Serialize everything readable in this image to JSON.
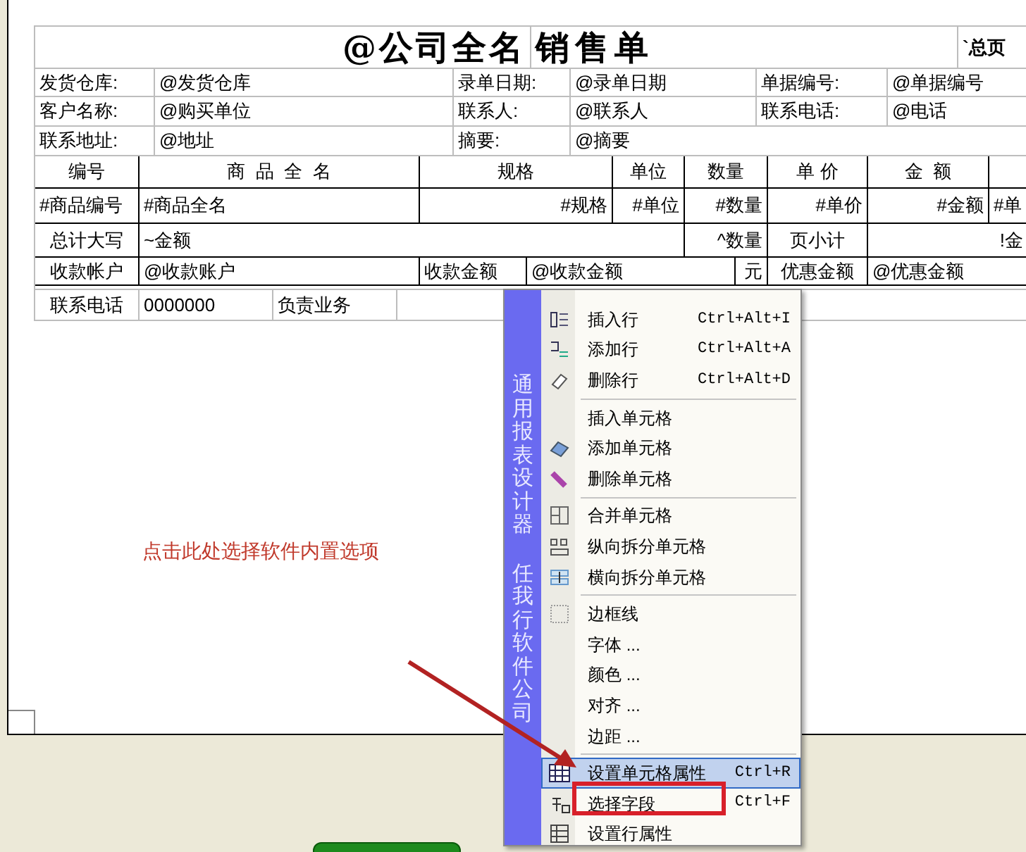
{
  "report": {
    "title_cells": [
      "@公司全名",
      "销售单",
      "`总页"
    ],
    "info_rows": [
      [
        "发货仓库:",
        "@发货仓库",
        "录单日期:",
        "@录单日期",
        "单据编号:",
        "@单据编号"
      ],
      [
        "客户名称:",
        "@购买单位",
        "联系人:",
        "@联系人",
        "联系电话:",
        "@电话"
      ],
      [
        "联系地址:",
        "@地址",
        "摘要:",
        "@摘要"
      ]
    ],
    "grid_header": [
      "编号",
      "商  品  全  名",
      "规格",
      "单位",
      "数量",
      "单 价",
      "金  额"
    ],
    "detail_row": [
      "#商品编号",
      "#商品全名",
      "#规格",
      "#单位",
      "#数量",
      "#单价",
      "#金额",
      "#单"
    ],
    "total_row": [
      "总计大写",
      "~金额",
      "^数量",
      "页小计",
      "!金"
    ],
    "payment_row": [
      "收款帐户",
      "@收款账户",
      "收款金额",
      "@收款金额",
      "元",
      "优惠金额",
      "@优惠金额"
    ],
    "footer_row": [
      "联系电话",
      "0000000",
      "负责业务"
    ]
  },
  "note": "点击此处选择软件内置选项",
  "context_menu": {
    "banner": [
      "通用报表设计器",
      "任我行软件公司"
    ],
    "items": [
      {
        "kind": "item",
        "label": "插入行",
        "shortcut": "Ctrl+Alt+I",
        "selected": false
      },
      {
        "kind": "item",
        "label": "添加行",
        "shortcut": "Ctrl+Alt+A",
        "selected": false
      },
      {
        "kind": "item",
        "label": "删除行",
        "shortcut": "Ctrl+Alt+D",
        "selected": false
      },
      {
        "kind": "separator"
      },
      {
        "kind": "item",
        "label": "插入单元格",
        "selected": false
      },
      {
        "kind": "item",
        "label": "添加单元格",
        "selected": false
      },
      {
        "kind": "item",
        "label": "删除单元格",
        "selected": false
      },
      {
        "kind": "separator"
      },
      {
        "kind": "item",
        "label": "合并单元格",
        "selected": false
      },
      {
        "kind": "item",
        "label": "纵向拆分单元格",
        "selected": false
      },
      {
        "kind": "item",
        "label": "横向拆分单元格",
        "selected": false
      },
      {
        "kind": "separator"
      },
      {
        "kind": "item",
        "label": "边框线",
        "selected": false
      },
      {
        "kind": "item",
        "label": "字体 ...",
        "selected": false
      },
      {
        "kind": "item",
        "label": "颜色 ...",
        "selected": false
      },
      {
        "kind": "item",
        "label": "对齐 ...",
        "selected": false
      },
      {
        "kind": "item",
        "label": "边距 ...",
        "selected": false
      },
      {
        "kind": "separator"
      },
      {
        "kind": "item",
        "label": "设置单元格属性",
        "shortcut": "Ctrl+R",
        "selected": true
      },
      {
        "kind": "item",
        "label": "选择字段",
        "shortcut": "Ctrl+F",
        "selected": false
      },
      {
        "kind": "item",
        "label": "设置行属性",
        "selected": false
      }
    ]
  }
}
